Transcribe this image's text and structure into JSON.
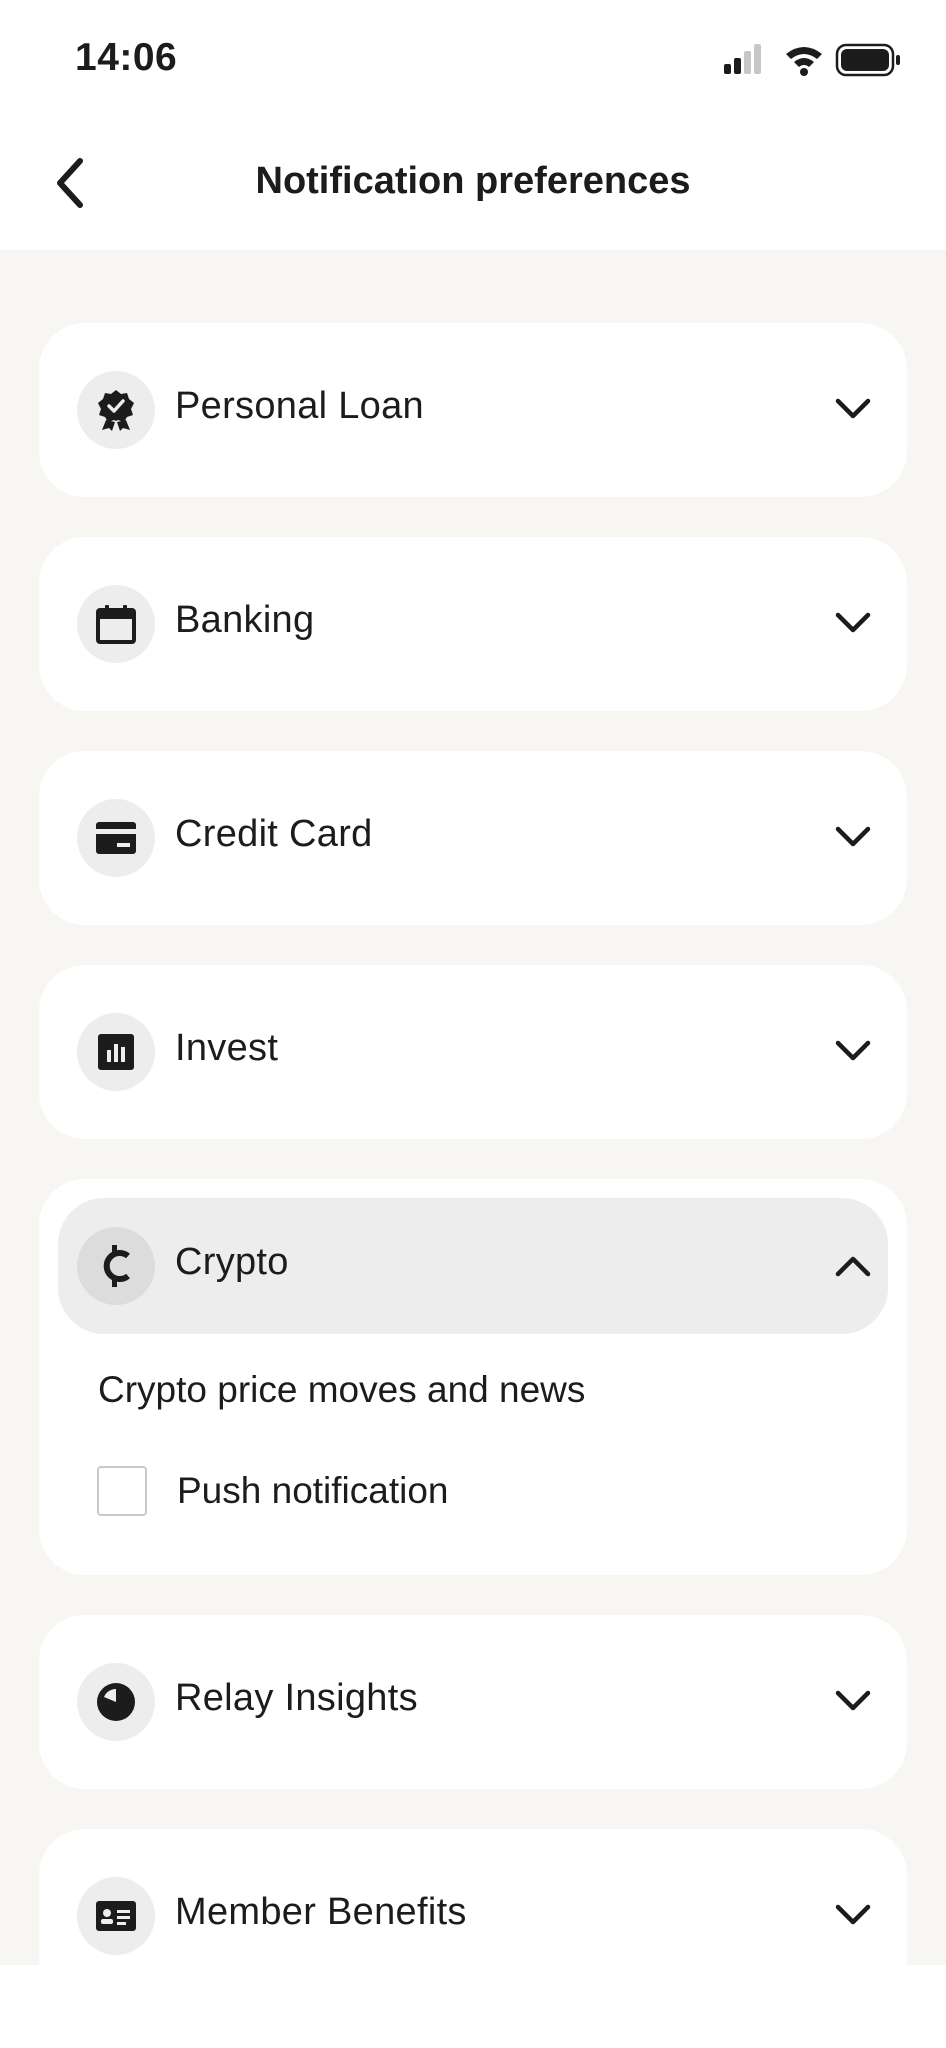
{
  "status_bar": {
    "time": "14:06",
    "signal_icon": "cellular-signal-icon",
    "wifi_icon": "wifi-icon",
    "battery_icon": "battery-icon"
  },
  "nav": {
    "title": "Notification preferences",
    "back_icon": "chevron-left-icon"
  },
  "sections": [
    {
      "label": "Personal Loan",
      "icon": "award-badge-icon",
      "expanded": false
    },
    {
      "label": "Banking",
      "icon": "calendar-icon",
      "expanded": false
    },
    {
      "label": "Credit Card",
      "icon": "credit-card-icon",
      "expanded": false
    },
    {
      "label": "Invest",
      "icon": "bar-chart-icon",
      "expanded": false
    },
    {
      "label": "Crypto",
      "icon": "cent-currency-icon",
      "expanded": true,
      "description": "Crypto price moves and news",
      "options": [
        {
          "label": "Push notification",
          "checked": false
        }
      ]
    },
    {
      "label": "Relay Insights",
      "icon": "pie-chart-icon",
      "expanded": false
    },
    {
      "label": "Member Benefits",
      "icon": "id-card-icon",
      "expanded": false
    }
  ],
  "colors": {
    "background": "#f7f6f3",
    "card": "#ffffff",
    "icon_circle": "#ededed",
    "expanded_header": "#ededed",
    "text": "#1c1c1c"
  }
}
